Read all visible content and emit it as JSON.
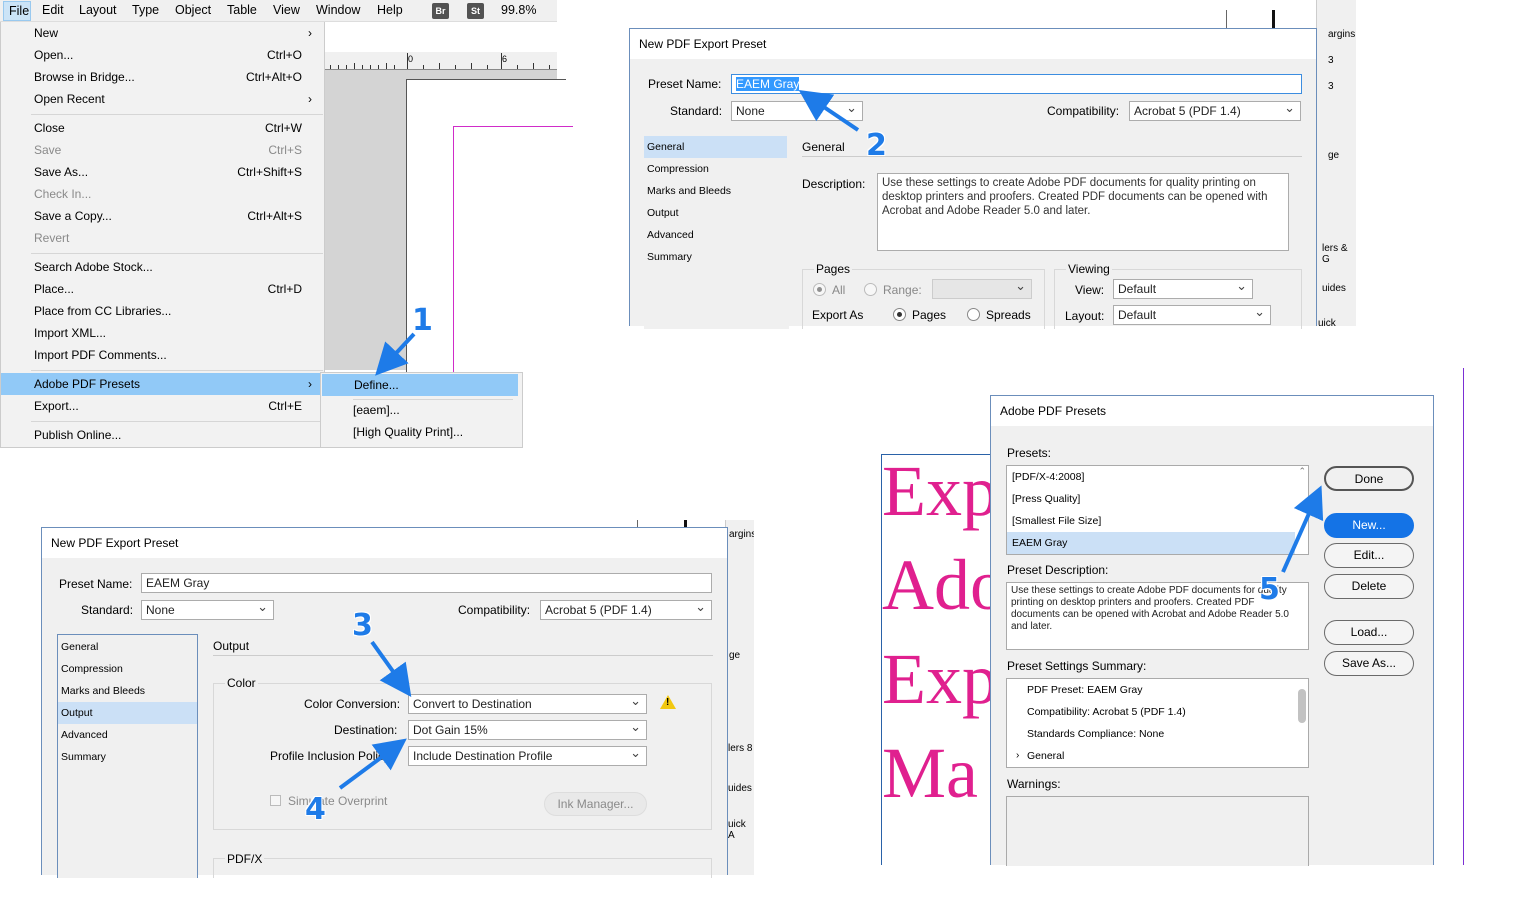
{
  "menubar": {
    "items": [
      "File",
      "Edit",
      "Layout",
      "Type",
      "Object",
      "Table",
      "View",
      "Window",
      "Help"
    ],
    "bridge_badge": "Br",
    "stock_badge": "St",
    "zoom": "99.8%"
  },
  "file_menu": {
    "new": "New",
    "open": "Open...",
    "open_sc": "Ctrl+O",
    "browse": "Browse in Bridge...",
    "browse_sc": "Ctrl+Alt+O",
    "recent": "Open Recent",
    "close": "Close",
    "close_sc": "Ctrl+W",
    "save": "Save",
    "save_sc": "Ctrl+S",
    "saveas": "Save As...",
    "saveas_sc": "Ctrl+Shift+S",
    "checkin": "Check In...",
    "savecopy": "Save a Copy...",
    "savecopy_sc": "Ctrl+Alt+S",
    "revert": "Revert",
    "searchstock": "Search Adobe Stock...",
    "place": "Place...",
    "place_sc": "Ctrl+D",
    "placecc": "Place from CC Libraries...",
    "importxml": "Import XML...",
    "importpdf": "Import PDF Comments...",
    "pdfpresets": "Adobe PDF Presets",
    "export": "Export...",
    "export_sc": "Ctrl+E",
    "publish": "Publish Online..."
  },
  "submenu": {
    "define": "Define...",
    "eaem": "[eaem]...",
    "hq": "[High Quality Print]..."
  },
  "ruler": {
    "t0": "0",
    "t6": "6"
  },
  "dialog1": {
    "title": "New PDF Export Preset",
    "preset_name_label": "Preset Name:",
    "preset_name": "EAEM Gray",
    "standard_label": "Standard:",
    "standard": "None",
    "compat_label": "Compatibility:",
    "compat": "Acrobat 5 (PDF 1.4)",
    "nav": [
      "General",
      "Compression",
      "Marks and Bleeds",
      "Output",
      "Advanced",
      "Summary"
    ],
    "section": "General",
    "desc_label": "Description:",
    "desc": "Use these settings to create Adobe PDF documents for quality printing on desktop printers and proofers.  Created PDF documents can be opened with Acrobat and Adobe Reader 5.0 and later.",
    "pages_label": "Pages",
    "all": "All",
    "range": "Range:",
    "export_as": "Export As",
    "pages": "Pages",
    "spreads": "Spreads",
    "viewing": "Viewing",
    "view_label": "View:",
    "view": "Default",
    "layout_label": "Layout:",
    "layout": "Default"
  },
  "dialog2": {
    "title": "New PDF Export Preset",
    "preset_name_label": "Preset Name:",
    "preset_name": "EAEM Gray",
    "standard_label": "Standard:",
    "standard": "None",
    "compat_label": "Compatibility:",
    "compat": "Acrobat 5 (PDF 1.4)",
    "nav": [
      "General",
      "Compression",
      "Marks and Bleeds",
      "Output",
      "Advanced",
      "Summary"
    ],
    "section": "Output",
    "color_group": "Color",
    "conv_label": "Color Conversion:",
    "conv": "Convert to Destination",
    "dest_label": "Destination:",
    "dest": "Dot Gain 15%",
    "profile_label": "Profile Inclusion Policy:",
    "profile": "Include Destination Profile",
    "simulate": "Simulate Overprint",
    "ink_manager": "Ink Manager...",
    "pdfx": "PDF/X"
  },
  "dialog3": {
    "title": "Adobe PDF Presets",
    "presets_label": "Presets:",
    "presets": [
      "[PDF/X-4:2008]",
      "[Press Quality]",
      "[Smallest File Size]",
      "EAEM Gray"
    ],
    "desc_label": "Preset Description:",
    "desc": "Use these settings to create Adobe PDF documents for quality printing on desktop printers and proofers.  Created PDF documents can be opened with Acrobat and Adobe Reader 5.0 and later.",
    "summary_label": "Preset Settings Summary:",
    "summary": [
      "PDF Preset: EAEM Gray",
      "Compatibility: Acrobat 5 (PDF 1.4)",
      "Standards Compliance: None",
      "General"
    ],
    "warnings_label": "Warnings:",
    "buttons": {
      "done": "Done",
      "new": "New...",
      "edit": "Edit...",
      "delete": "Delete",
      "load": "Load...",
      "saveas": "Save As..."
    }
  },
  "background_text": [
    "Exp",
    "Ado",
    "Exp",
    "Ma"
  ],
  "panel_fragments": {
    "a": "argins",
    "b": "ge",
    "c": "lers & G",
    "d": "uides",
    "e": "uick Actio",
    "f": "3",
    "g": "3"
  },
  "panel_fragments2": {
    "a": "argins",
    "b": "ge",
    "c": "lers 8",
    "d": "uides",
    "e": "uick A"
  },
  "callouts": [
    "1",
    "2",
    "3",
    "4",
    "5"
  ],
  "colors": {
    "accent": "#1e7be8",
    "highlight": "#91c9f7",
    "magenta": "#e0208f",
    "warning": "#f2c811"
  }
}
